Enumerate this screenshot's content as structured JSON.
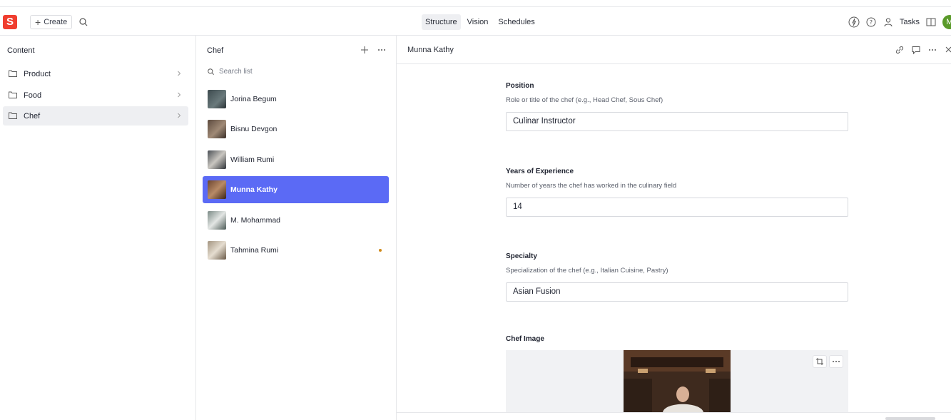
{
  "navbar": {
    "logo_letter": "S",
    "create_label": "Create",
    "tabs": [
      {
        "label": "Structure",
        "active": true
      },
      {
        "label": "Vision",
        "active": false
      },
      {
        "label": "Schedules",
        "active": false
      }
    ],
    "tasks_label": "Tasks",
    "avatar_letter": "M"
  },
  "content_pane": {
    "title": "Content",
    "items": [
      {
        "label": "Product",
        "active": false
      },
      {
        "label": "Food",
        "active": false
      },
      {
        "label": "Chef",
        "active": true
      }
    ]
  },
  "list_pane": {
    "title": "Chef",
    "search_placeholder": "Search list",
    "items": [
      {
        "label": "Jorina Begum",
        "active": false,
        "thumb_color": "#3d4a4e"
      },
      {
        "label": "Bisnu Devgon",
        "active": false,
        "thumb_color": "#5c4a3e"
      },
      {
        "label": "William Rumi",
        "active": false,
        "thumb_color": "#4a4f55"
      },
      {
        "label": "Munna Kathy",
        "active": true,
        "thumb_color": "#6b4530"
      },
      {
        "label": "M. Mohammad",
        "active": false,
        "thumb_color": "#7b8a86"
      },
      {
        "label": "Tahmina Rumi",
        "active": false,
        "thumb_color": "#a39480",
        "unpublished": true
      }
    ]
  },
  "document": {
    "title": "Munna Kathy",
    "fields": {
      "position": {
        "title": "Position",
        "description": "Role or title of the chef (e.g., Head Chef, Sous Chef)",
        "value": "Culinar Instructor"
      },
      "experience": {
        "title": "Years of Experience",
        "description": "Number of years the chef has worked in the culinary field",
        "value": "14"
      },
      "specialty": {
        "title": "Specialty",
        "description": "Specialization of the chef (e.g., Italian Cuisine, Pastry)",
        "value": "Asian Fusion"
      },
      "image": {
        "title": "Chef Image"
      }
    }
  },
  "colors": {
    "accent": "#5b6af5",
    "brand": "#f03e2f",
    "unpublished_dot": "#d08a1a"
  },
  "icons": [
    "search-icon",
    "plus-icon",
    "folder-icon",
    "chevron-right-icon",
    "more-icon",
    "link-icon",
    "comment-icon",
    "close-icon",
    "crop-icon",
    "help-icon",
    "bolt-icon",
    "people-icon",
    "split-pane-icon"
  ]
}
